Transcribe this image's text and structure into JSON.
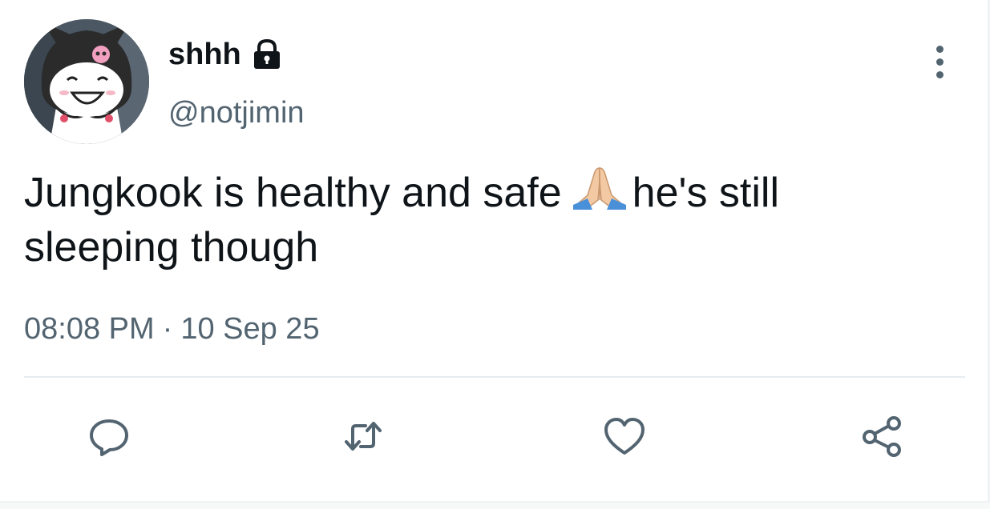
{
  "user": {
    "display_name": "shhh",
    "handle": "@notjimin",
    "avatar_icon": "kuromi-avatar",
    "protected_icon": "lock-icon"
  },
  "tweet": {
    "text_before_emoji": "Jungkook is healthy and safe",
    "emoji": "folded-hands-emoji",
    "text_after_emoji": "he's still sleeping though",
    "time": "08:08 PM",
    "separator": "·",
    "date": "10 Sep 25"
  },
  "actions": [
    {
      "name": "reply",
      "icon": "reply-icon"
    },
    {
      "name": "retweet",
      "icon": "retweet-icon"
    },
    {
      "name": "like",
      "icon": "heart-icon"
    },
    {
      "name": "share",
      "icon": "share-icon"
    }
  ],
  "colors": {
    "primary_text": "#0f1419",
    "secondary_text": "#536471",
    "divider": "#e6ecf0",
    "background": "#ffffff"
  }
}
